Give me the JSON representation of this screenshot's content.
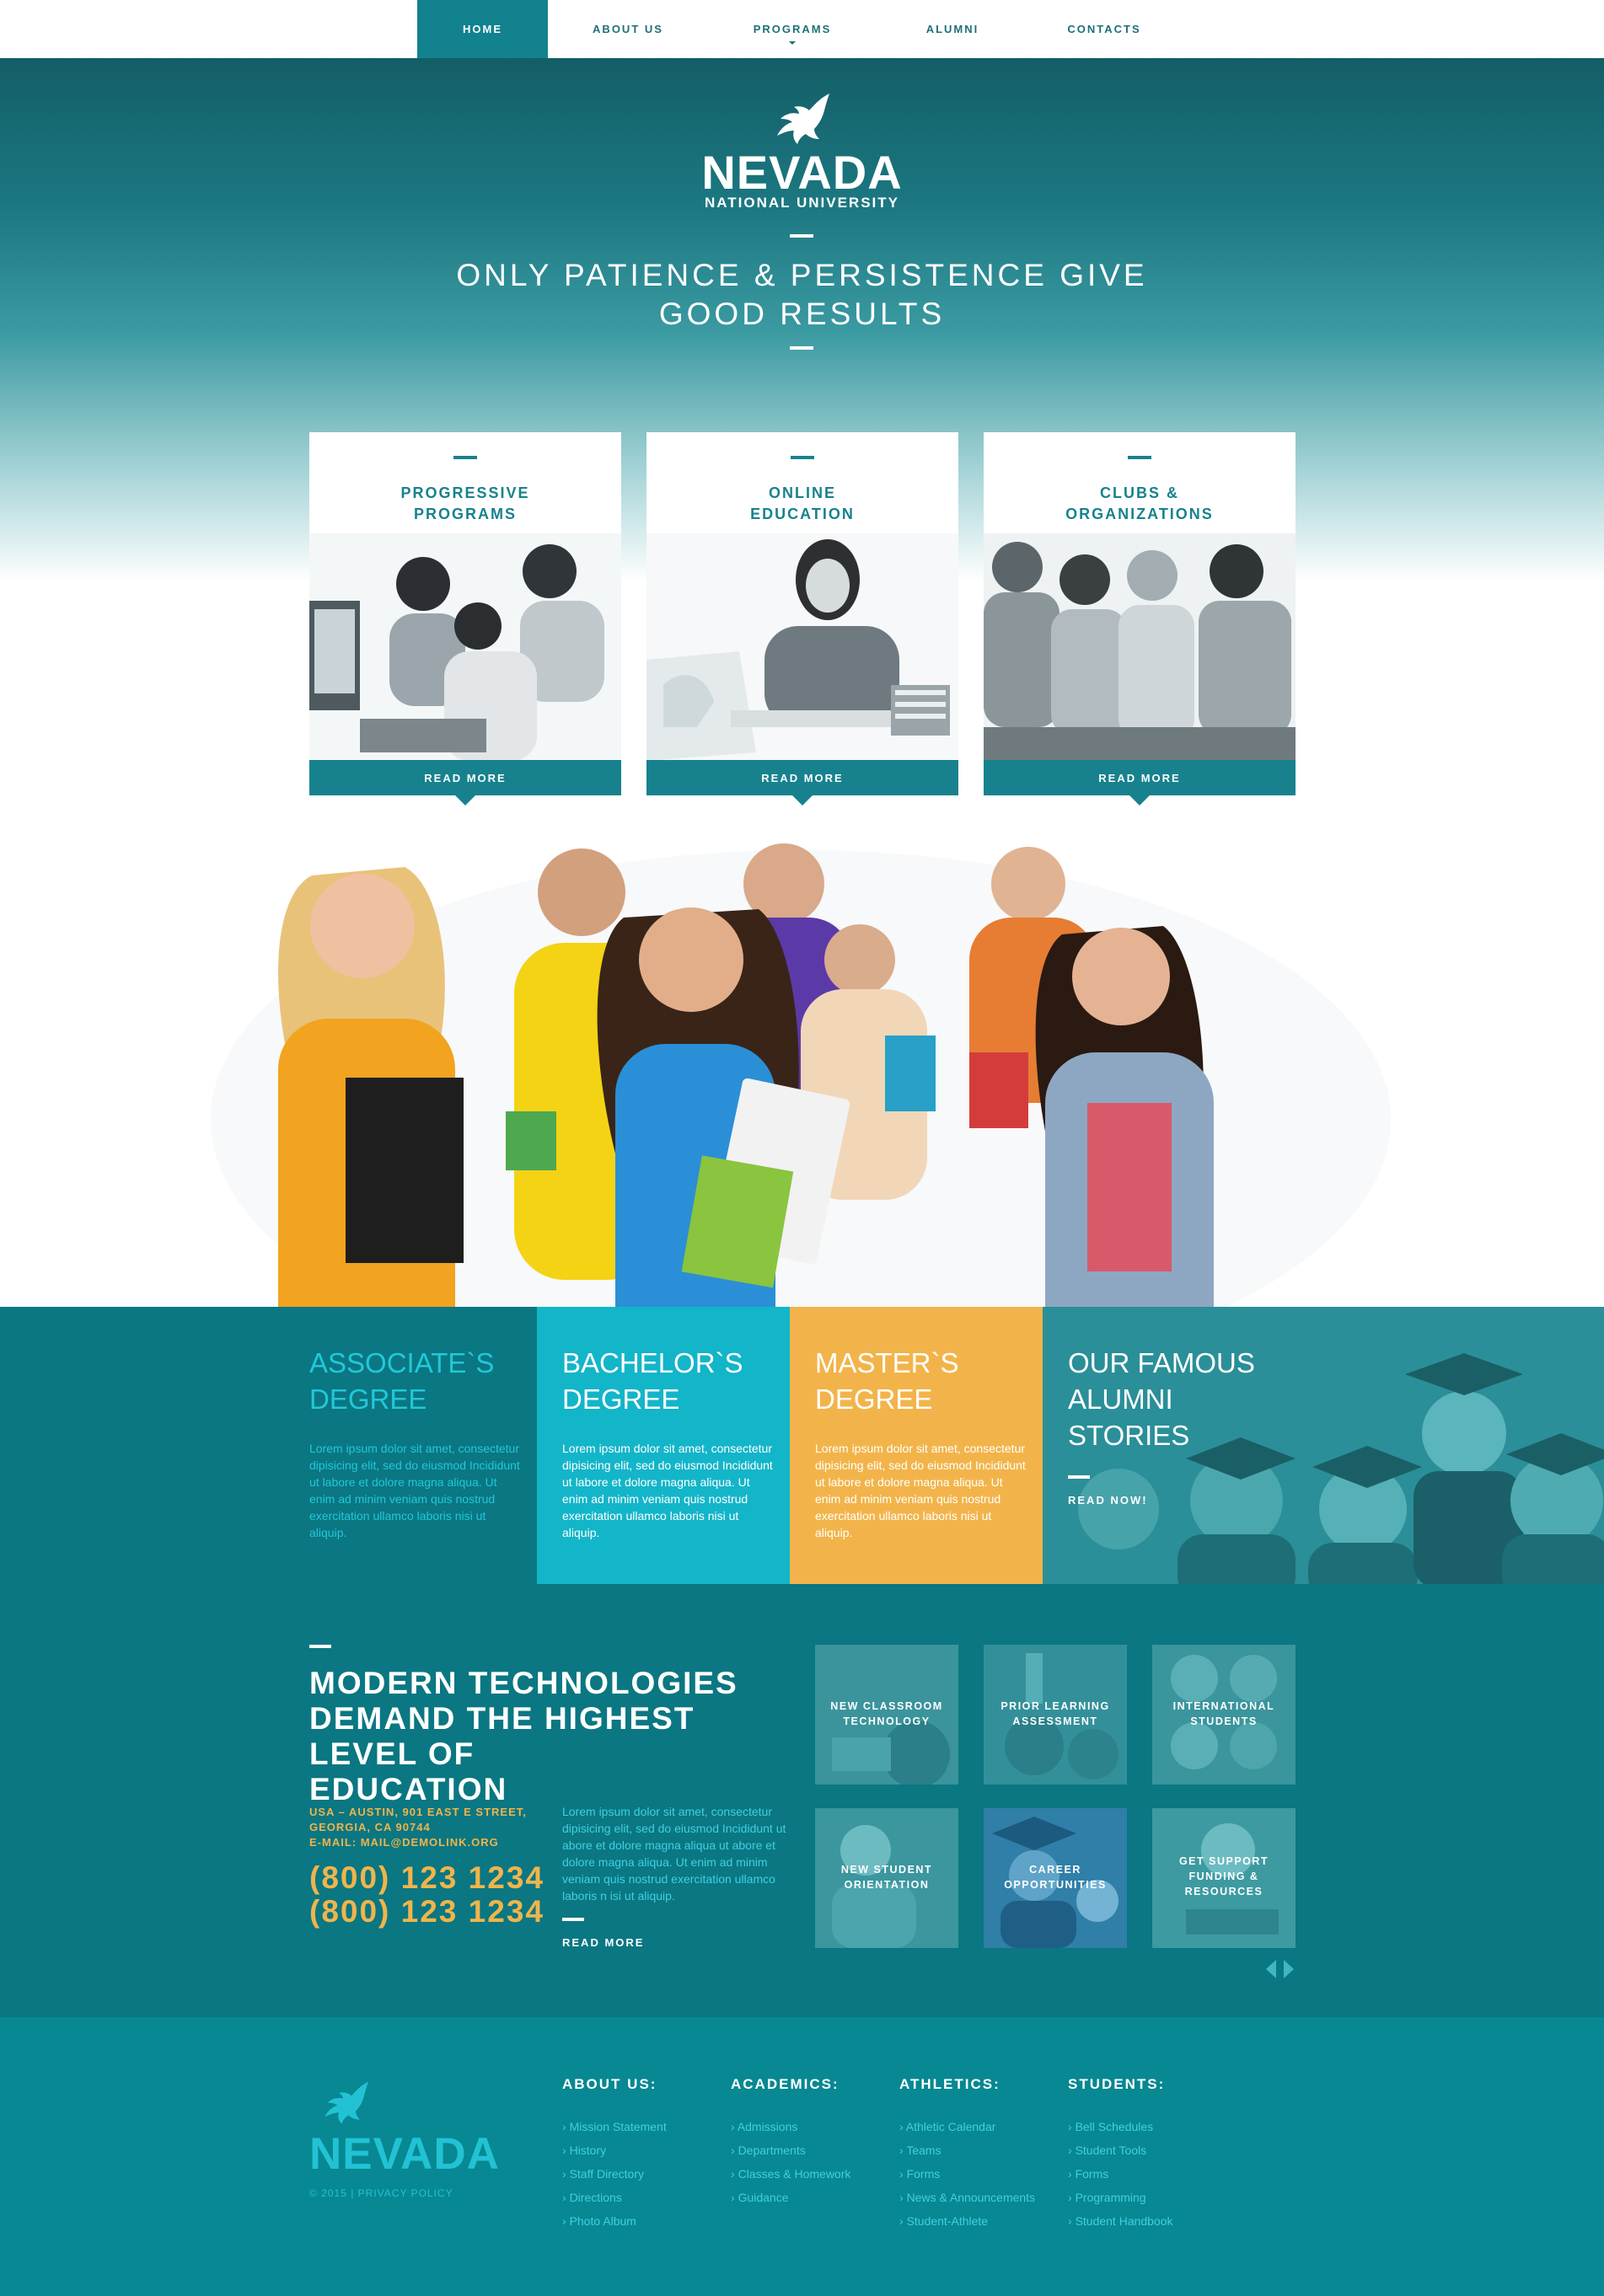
{
  "nav": {
    "items": [
      {
        "label": "HOME",
        "active": true
      },
      {
        "label": "ABOUT US"
      },
      {
        "label": "PROGRAMS",
        "has_dropdown": true
      },
      {
        "label": "ALUMNI"
      },
      {
        "label": "CONTACTS"
      }
    ]
  },
  "hero": {
    "brand": "NEVADA",
    "brand_sub": "NATIONAL UNIVERSITY",
    "tagline_line1": "ONLY PATIENCE & PERSISTENCE GIVE",
    "tagline_line2": "GOOD RESULTS"
  },
  "cards": [
    {
      "title_line1": "PROGRESSIVE",
      "title_line2": "PROGRAMS",
      "button": "READ MORE"
    },
    {
      "title_line1": "ONLINE",
      "title_line2": "EDUCATION",
      "button": "READ MORE"
    },
    {
      "title_line1": "CLUBS &",
      "title_line2": "ORGANIZATIONS",
      "button": "READ MORE"
    }
  ],
  "degrees": [
    {
      "title_line1": "ASSOCIATE`S",
      "title_line2": "DEGREE",
      "text": "Lorem ipsum dolor sit amet, consectetur dipisicing elit, sed do eiusmod Incididunt ut labore et dolore magna aliqua. Ut enim ad minim veniam quis nostrud exercitation ullamco laboris nisi ut aliquip.",
      "bg": "#0a7782",
      "title_color": "#22c7da",
      "text_color": "#22c7da"
    },
    {
      "title_line1": "BACHELOR`S",
      "title_line2": "DEGREE",
      "text": "Lorem ipsum dolor sit amet, consectetur dipisicing elit, sed do eiusmod Incididunt ut labore et dolore magna aliqua. Ut enim ad minim veniam quis nostrud exercitation ullamco laboris nisi ut aliquip.",
      "bg": "#13b5c9",
      "title_color": "#ffffff",
      "text_color": "#ffffff"
    },
    {
      "title_line1": "MASTER`S",
      "title_line2": "DEGREE",
      "text": "Lorem ipsum dolor sit amet, consectetur dipisicing elit, sed do eiusmod Incididunt ut labore et dolore magna aliqua. Ut enim ad minim veniam quis nostrud exercitation ullamco laboris nisi ut aliquip.",
      "bg": "#f2b44a",
      "title_color": "#ffffff",
      "text_color": "#ffffff"
    }
  ],
  "alumni": {
    "title_line1": "OUR FAMOUS",
    "title_line2": "ALUMNI",
    "title_line3": "STORIES",
    "link": "READ NOW!"
  },
  "modern": {
    "title_line1": "MODERN TECHNOLOGIES",
    "title_line2": "DEMAND THE HIGHEST LEVEL OF",
    "title_line3": "EDUCATION",
    "address_line1": "USA – AUSTIN, 901 EAST E STREET,",
    "address_line2": "GEORGIA, CA 90744",
    "email": "E-MAIL: MAIL@DEMOLINK.ORG",
    "phone1": "(800) 123 1234",
    "phone2": "(800) 123 1234",
    "text": "Lorem ipsum dolor sit amet, consectetur dipisicing elit, sed do eiusmod Incididunt ut abore et dolore magna aliqua ut abore et dolore magna aliqua. Ut enim ad minim veniam quis nostrud exercitation ullamco laboris n isi ut aliquip.",
    "read_more": "READ MORE",
    "tiles": [
      {
        "line1": "NEW CLASSROOM",
        "line2": "TECHNOLOGY",
        "line3": ""
      },
      {
        "line1": "PRIOR LEARNING",
        "line2": "ASSESSMENT",
        "line3": ""
      },
      {
        "line1": "INTERNATIONAL",
        "line2": "STUDENTS",
        "line3": ""
      },
      {
        "line1": "NEW STUDENT",
        "line2": "ORIENTATION",
        "line3": ""
      },
      {
        "line1": "CAREER",
        "line2": "OPPORTUNITIES",
        "line3": ""
      },
      {
        "line1": "GET SUPPORT",
        "line2": "FUNDING &",
        "line3": "RESOURCES"
      }
    ]
  },
  "footer": {
    "brand": "NEVADA",
    "copyright": "© 2015 | PRIVACY POLICY",
    "columns": [
      {
        "title": "ABOUT US:",
        "links": [
          "Mission Statement",
          "History",
          "Staff Directory",
          "Directions",
          "Photo Album"
        ]
      },
      {
        "title": "ACADEMICS:",
        "links": [
          "Admissions",
          "Departments",
          "Classes & Homework",
          "Guidance"
        ]
      },
      {
        "title": "ATHLETICS:",
        "links": [
          "Athletic Calendar",
          "Teams",
          "Forms",
          "News & Announcements",
          "Student-Athlete"
        ]
      },
      {
        "title": "STUDENTS:",
        "links": [
          "Bell Schedules",
          "Student Tools",
          "Forms",
          "Programming",
          "Student Handbook"
        ]
      }
    ]
  }
}
